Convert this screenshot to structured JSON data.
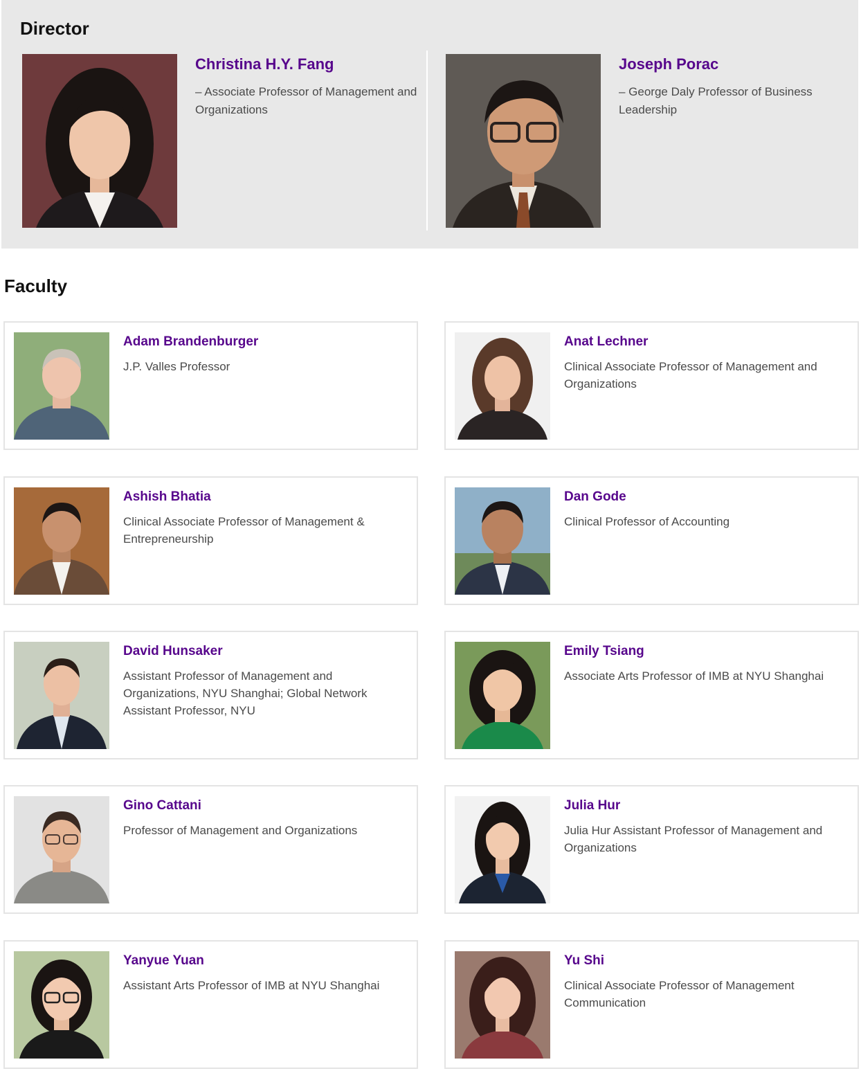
{
  "director": {
    "heading": "Director",
    "people": [
      {
        "name": "Christina H.Y. Fang",
        "title": "– Associate Professor of Management and Organizations"
      },
      {
        "name": "Joseph Porac",
        "title": "– George Daly Professor of Business Leadership"
      }
    ]
  },
  "faculty": {
    "heading": "Faculty",
    "people": [
      {
        "name": "Adam Brandenburger",
        "title": "J.P. Valles Professor"
      },
      {
        "name": "Anat Lechner",
        "title": "Clinical Associate Professor of Management and Organizations"
      },
      {
        "name": "Ashish Bhatia",
        "title": "Clinical Associate Professor of Management & Entrepreneurship"
      },
      {
        "name": "Dan Gode",
        "title": "Clinical Professor of Accounting"
      },
      {
        "name": "David Hunsaker",
        "title": "Assistant Professor of Management and Organizations, NYU Shanghai; Global Network Assistant Professor, NYU"
      },
      {
        "name": "Emily Tsiang",
        "title": "Associate Arts Professor of IMB at NYU Shanghai"
      },
      {
        "name": "Gino Cattani",
        "title": "Professor of Management and Organizations"
      },
      {
        "name": "Julia Hur",
        "title": "Julia Hur Assistant Professor of Management and Organizations"
      },
      {
        "name": "Yanyue Yuan",
        "title": "Assistant Arts Professor of IMB at NYU Shanghai"
      },
      {
        "name": "Yu Shi",
        "title": "Clinical Associate Professor of Management Communication"
      }
    ]
  },
  "colors": {
    "accent": "#57068c",
    "director_bg": "#e8e8e8",
    "card_border": "#e4e4e4"
  }
}
